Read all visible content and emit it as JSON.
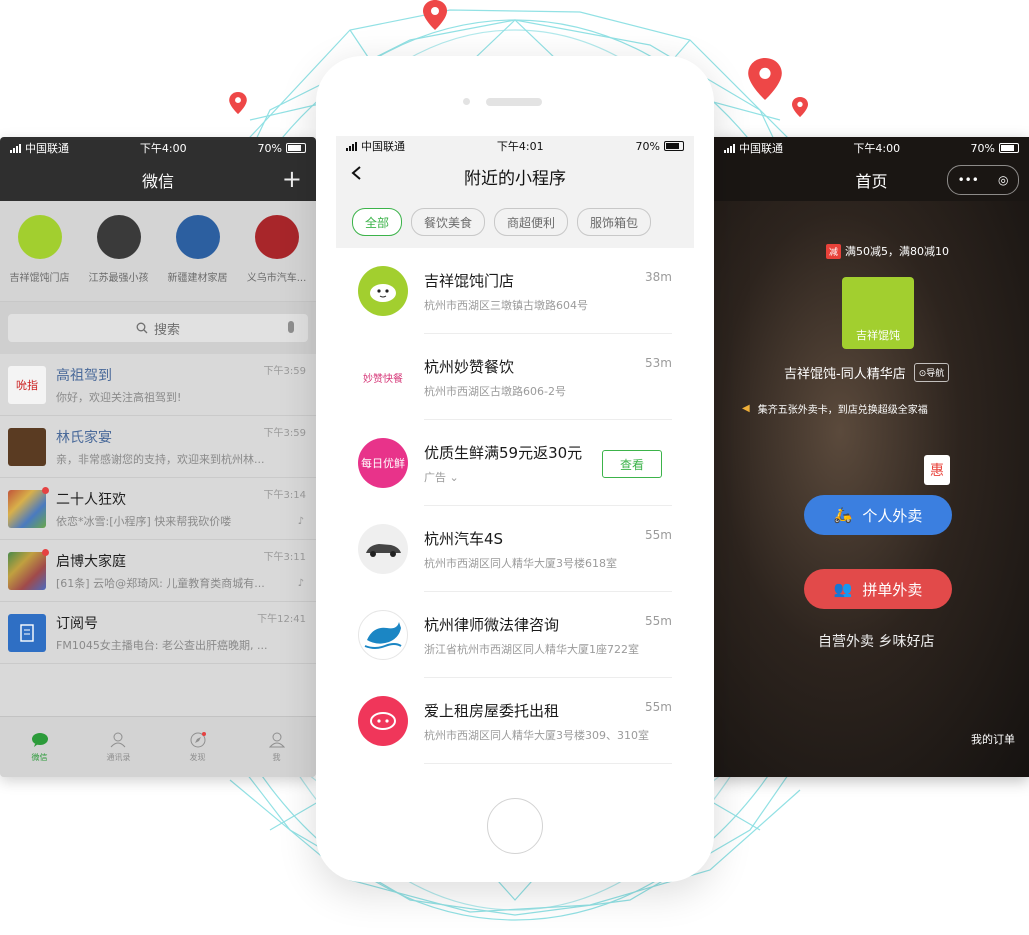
{
  "colors": {
    "accent_green": "#3cb34a",
    "pin_red": "#ee4747",
    "globe_teal": "#5fd0d4"
  },
  "left_phone": {
    "status": {
      "carrier": "中国联通",
      "time": "下午4:00",
      "battery": "70%"
    },
    "title": "微信",
    "plus_icon": "+",
    "mini_programs": [
      {
        "label": "吉祥馄饨门店"
      },
      {
        "label": "江苏最强小孩"
      },
      {
        "label": "新疆建材家居"
      },
      {
        "label": "义乌市汽车..."
      }
    ],
    "search_placeholder": "搜索",
    "chats": [
      {
        "name": "高祖驾到",
        "msg": "你好，欢迎关注高祖驾到!",
        "time": "下午3:59",
        "avatar_text": "吮指"
      },
      {
        "name": "林氏家宴",
        "msg": "亲，非常感谢您的支持，欢迎来到杭州林...",
        "time": "下午3:59"
      },
      {
        "name": "二十人狂欢",
        "msg": "依恋*冰雪:[小程序] 快来帮我砍价喽",
        "time": "下午3:14"
      },
      {
        "name": "启博大家庭",
        "msg": "[61条] 云哈@郑琦风: 儿童教育类商城有...",
        "time": "下午3:11"
      },
      {
        "name": "订阅号",
        "msg": "FM1045女主播电台: 老公查出肝癌晚期, ...",
        "time": "下午12:41"
      }
    ],
    "tabs": [
      {
        "label": "微信"
      },
      {
        "label": "通讯录"
      },
      {
        "label": "发现"
      },
      {
        "label": "我"
      }
    ]
  },
  "center_phone": {
    "status": {
      "carrier": "中国联通",
      "time": "下午4:01",
      "battery": "70%"
    },
    "title": "附近的小程序",
    "chips": [
      "全部",
      "餐饮美食",
      "商超便利",
      "服饰箱包"
    ],
    "items": [
      {
        "name": "吉祥馄饨门店",
        "addr": "杭州市西湖区三墩镇古墩路604号",
        "dist": "38m"
      },
      {
        "name": "杭州妙赞餐饮",
        "addr": "杭州市西湖区古墩路606-2号",
        "dist": "53m",
        "logo_text": "妙赞快餐"
      },
      {
        "name": "优质生鲜满59元返30元",
        "addr": "广告",
        "button": "查看",
        "logo_text": "每日优鲜"
      },
      {
        "name": "杭州汽车4S",
        "addr": "杭州市西湖区同人精华大厦3号楼618室",
        "dist": "55m"
      },
      {
        "name": "杭州律师微法律咨询",
        "addr": "浙江省杭州市西湖区同人精华大厦1座722室",
        "dist": "55m"
      },
      {
        "name": "爱上租房屋委托出租",
        "addr": "杭州市西湖区同人精华大厦3号楼309、310室",
        "dist": "55m"
      }
    ]
  },
  "right_phone": {
    "status": {
      "carrier": "中国联通",
      "time": "下午4:00",
      "battery": "70%"
    },
    "title": "首页",
    "promo_tag": "减",
    "promo": "满50减5，满80减10",
    "logo_text": "吉祥馄饨",
    "store_name": "吉祥馄饨-同人精华店",
    "nav_label": "导航",
    "notice": "集齐五张外卖卡，到店兑换超级全家福",
    "hui": "惠",
    "btn_delivery": "个人外卖",
    "btn_group": "拼单外卖",
    "slogan": "自营外卖 乡味好店",
    "orders": "我的订单"
  }
}
